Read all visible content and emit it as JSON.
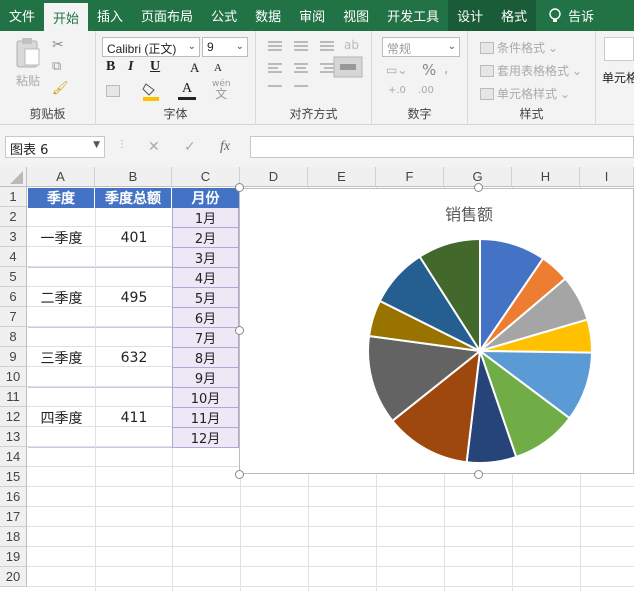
{
  "tabs": [
    {
      "label": "文件",
      "active": false
    },
    {
      "label": "开始",
      "active": true
    },
    {
      "label": "插入",
      "active": false
    },
    {
      "label": "页面布局",
      "active": false
    },
    {
      "label": "公式",
      "active": false
    },
    {
      "label": "数据",
      "active": false
    },
    {
      "label": "审阅",
      "active": false
    },
    {
      "label": "视图",
      "active": false
    },
    {
      "label": "开发工具",
      "active": false
    },
    {
      "label": "设计",
      "active": false
    },
    {
      "label": "格式",
      "active": false
    }
  ],
  "tell_me": "告诉",
  "ribbon": {
    "clipboard": {
      "paste": "粘贴",
      "label": "剪贴板"
    },
    "font": {
      "name": "Calibri (正文)",
      "size": "9",
      "bold": "B",
      "italic": "I",
      "underline": "U",
      "grow": "A",
      "shrink": "A",
      "color_a": "A",
      "wen": "wén",
      "label": "字体"
    },
    "alignment": {
      "label": "对齐方式"
    },
    "number": {
      "format": "常规",
      "percent": "%",
      "label": "数字"
    },
    "styles": {
      "conditional": "条件格式",
      "table": "套用表格格式",
      "cell": "单元格样式",
      "label": "样式"
    },
    "cells": {
      "label": "单元格"
    }
  },
  "formula_bar": {
    "name_box": "图表 6",
    "cancel": "✕",
    "enter": "✓",
    "fx": "fx",
    "value": ""
  },
  "columns": [
    "A",
    "B",
    "C",
    "D",
    "E",
    "F",
    "G",
    "H",
    "I"
  ],
  "rows": [
    "1",
    "2",
    "3",
    "4",
    "5",
    "6",
    "7",
    "8",
    "9",
    "10",
    "11",
    "12",
    "13",
    "14",
    "15",
    "16",
    "17",
    "18",
    "19",
    "20"
  ],
  "table": {
    "headers": [
      "季度",
      "季度总额",
      "月份"
    ],
    "quarters": [
      {
        "name": "一季度",
        "total": "401"
      },
      {
        "name": "二季度",
        "total": "495"
      },
      {
        "name": "三季度",
        "total": "632"
      },
      {
        "name": "四季度",
        "total": "411"
      }
    ],
    "months": [
      "1月",
      "2月",
      "3月",
      "4月",
      "5月",
      "6月",
      "7月",
      "8月",
      "9月",
      "10月",
      "11月",
      "12月"
    ]
  },
  "chart_data": {
    "type": "pie",
    "title": "销售额",
    "slice_colors": [
      "#4472c4",
      "#ed7d31",
      "#a5a5a5",
      "#ffc000",
      "#5b9bd5",
      "#70ad47",
      "#264478",
      "#9e480e",
      "#636363",
      "#997300",
      "#255e91",
      "#43682b"
    ],
    "values": [
      40,
      18,
      28,
      20,
      42,
      40,
      30,
      52,
      54,
      22,
      36,
      38
    ]
  },
  "colors": {
    "accent": "#217346",
    "header_fill": "#4472c4",
    "month_fill": "#ede7f6"
  }
}
